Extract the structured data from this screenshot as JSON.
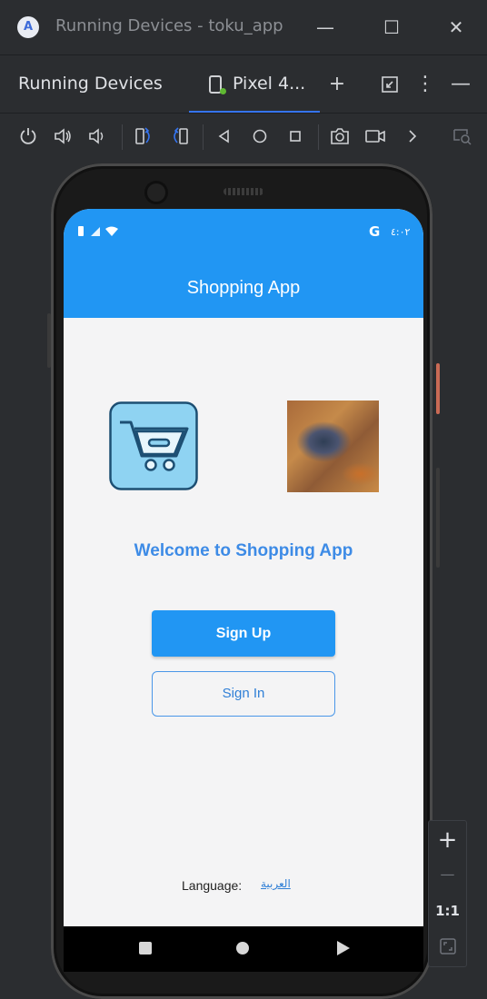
{
  "window": {
    "title": "Running Devices - toku_app",
    "logo_letter": "A",
    "minimize_glyph": "—",
    "maximize_glyph": "☐",
    "close_glyph": "✕"
  },
  "toolwindow": {
    "title": "Running Devices",
    "device_tab": "Pixel 4...",
    "add_glyph": "+",
    "menu_glyph": "⋮",
    "hide_glyph": "—"
  },
  "toolbar": {
    "icons": [
      "power-icon",
      "volume-up-icon",
      "volume-down-icon",
      "rotate-left-icon",
      "rotate-right-icon",
      "back-icon",
      "home-icon",
      "overview-icon",
      "screenshot-icon",
      "screen-record-icon",
      "more-chevron-icon",
      "device-mirror-icon"
    ]
  },
  "phone": {
    "status_time": "٤:٠٢",
    "status_g": "G",
    "app": {
      "title": "Shopping App",
      "welcome": "Welcome to Shopping App",
      "signup_label": "Sign Up",
      "signin_label": "Sign In",
      "language_label": "Language:",
      "language_link": "العربية"
    },
    "colors": {
      "primary": "#2196f3",
      "welcome_text": "#3d8be6",
      "background": "#f4f4f5"
    }
  },
  "zoom": {
    "zoom_in": "+",
    "zoom_out": "—",
    "actual_size": "1:1"
  }
}
